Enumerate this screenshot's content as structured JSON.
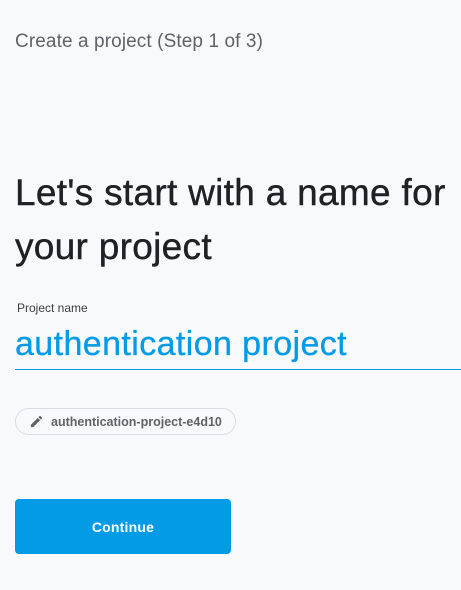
{
  "header": {
    "step_title": "Create a project (Step 1 of 3)"
  },
  "main": {
    "headline": "Let's start with a name for your project",
    "project_name_label": "Project name",
    "project_name_value": "authentication project",
    "project_id_chip": "authentication-project-e4d10",
    "project_id_chip_icon": "pencil-icon",
    "continue_label": "Continue"
  },
  "colors": {
    "accent": "#039be5",
    "background": "#f8f9fa",
    "headline_text": "#202124",
    "secondary_text": "#5f6368"
  }
}
